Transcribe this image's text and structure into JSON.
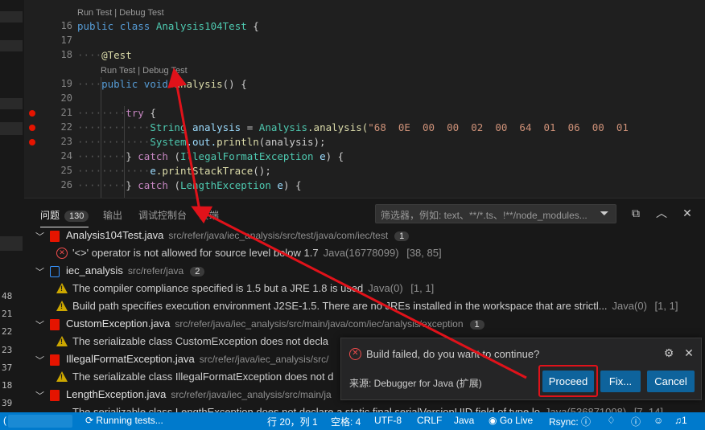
{
  "left_strip": {
    "line_numbers": [
      "48",
      "21",
      "22",
      "23",
      "37",
      "18",
      "39"
    ]
  },
  "editor": {
    "codelens_class": "Run Test | Debug Test",
    "codelens_method": "Run Test | Debug Test",
    "gutter": [
      "16",
      "17",
      "18",
      "19",
      "20",
      "21",
      "22",
      "23",
      "24",
      "25",
      "26"
    ],
    "lines": {
      "l16_kw1": "public",
      "l16_kw2": "class",
      "l16_cls": "Analysis104Test",
      "l16_rest": " {",
      "l18_ann": "@Test",
      "l19_kw1": "public",
      "l19_kw2": "void",
      "l19_fn": "analysis",
      "l19_rest": "() {",
      "l21_kw": "try",
      "l21_rest": " {",
      "l22_cls": "String",
      "l22_var": "analysis",
      "l22_eq": " = ",
      "l22_cls2": "Analysis",
      "l22_fn": ".analysis(",
      "l22_str": "\"68  0E  00  00  02  00  64  01  06  00  01",
      "l23_cls": "System",
      "l23_rest": ".out.",
      "l23_fn": "println",
      "l23_arg": "(analysis);",
      "l24_pre": "} ",
      "l24_kw": "catch",
      "l24_paren": " (",
      "l24_cls": "IllegalFormatException",
      "l24_var": " e",
      "l24_rest": ") {",
      "l25_var": "e",
      "l25_fn": ".printStackTrace",
      "l25_rest": "();",
      "l26_pre": "} ",
      "l26_kw": "catch",
      "l26_paren": " (",
      "l26_cls": "LengthException",
      "l26_var": " e",
      "l26_rest": ") {"
    }
  },
  "panel": {
    "tabs": [
      {
        "label": "问题",
        "badge": "130"
      },
      {
        "label": "输出"
      },
      {
        "label": "调试控制台"
      },
      {
        "label": "终端"
      }
    ],
    "filter_placeholder": "筛选器，例如: text、**/*.ts、!**/node_modules...",
    "groups": [
      {
        "file": "Analysis104Test.java",
        "path": "src/refer/java/iec_analysis/src/test/java/com/iec/test",
        "count": "1",
        "items": [
          {
            "severity": "error",
            "text": "'<>' operator is not allowed for source level below 1.7",
            "source": "Java(16778099)",
            "pos": "[38, 85]"
          }
        ]
      },
      {
        "file": "iec_analysis",
        "path": "src/refer/java",
        "count": "2",
        "items": [
          {
            "severity": "warning",
            "text": "The compiler compliance specified is 1.5 but a JRE 1.8 is used",
            "source": "Java(0)",
            "pos": "[1, 1]"
          },
          {
            "severity": "warning",
            "text": "Build path specifies execution environment J2SE-1.5. There are no JREs installed in the workspace that are strictl...",
            "source": "Java(0)",
            "pos": "[1, 1]"
          }
        ]
      },
      {
        "file": "CustomException.java",
        "path": "src/refer/java/iec_analysis/src/main/java/com/iec/analysis/exception",
        "count": "1",
        "items": [
          {
            "severity": "warning",
            "text": "The serializable class CustomException does not decla"
          }
        ]
      },
      {
        "file": "IllegalFormatException.java",
        "path": "src/refer/java/iec_analysis/src/",
        "items": [
          {
            "severity": "warning",
            "text": "The serializable class IllegalFormatException does not d"
          }
        ]
      },
      {
        "file": "LengthException.java",
        "path": "src/refer/java/iec_analysis/src/main/ja",
        "items": []
      }
    ],
    "cut_row_text": "The serializable class LengthException does not declare a static final serialVersionUID field of type lo",
    "cut_row_src": "Java(536871008)",
    "cut_row_pos": "[7, 14]"
  },
  "notification": {
    "message": "Build failed, do you want to continue?",
    "source": "来源: Debugger for Java (扩展)",
    "buttons": {
      "proceed": "Proceed",
      "fix": "Fix...",
      "cancel": "Cancel"
    }
  },
  "statusbar": {
    "running": "Running tests...",
    "position": "行 20，列 1",
    "spaces": "空格: 4",
    "encoding": "UTF-8",
    "eol": "CRLF",
    "language": "Java",
    "golive": "Go Live",
    "rsync": "Rsync:",
    "bell_count": "1"
  },
  "colors": {
    "accent": "#007acc",
    "button": "#0e639c",
    "highlight_ring": "#e0121a",
    "arrow": "#e0121a"
  }
}
